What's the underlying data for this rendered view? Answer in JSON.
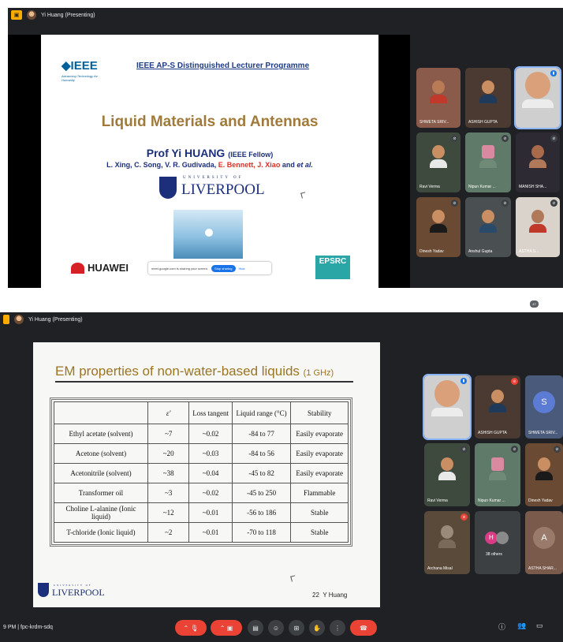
{
  "screenshot1": {
    "topbar": {
      "pin_icon": "present-to-all-icon",
      "presenter_label": "Yi Huang (Presenting)"
    },
    "slide": {
      "ieee_logo": "IEEE",
      "ieee_tagline": "Advancing Technology for Humanity",
      "programme": "IEEE AP-S Distinguished Lecturer Programme",
      "title": "Liquid Materials and Antennas",
      "presenter": "Prof Yi HUANG",
      "presenter_suffix": "(IEEE Fellow)",
      "authors_black": "L. Xing, C. Song, V. R. Gudivada,",
      "authors_red": "E. Bennett, J. Xiao",
      "authors_and": "and",
      "authors_etal": "et al.",
      "university_small": "UNIVERSITY OF",
      "university_big": "LIVERPOOL",
      "sponsor_left": "HUAWEI",
      "sponsor_right": "EPSRC",
      "share_notice": "meet.google.com is sharing your screen.",
      "share_stop": "Stop sharing",
      "share_hide": "Hide"
    },
    "tiles": [
      {
        "name": "SHWETA SRIV..."
      },
      {
        "name": "ASHISH GUPTA"
      },
      {
        "name": ""
      },
      {
        "name": "Ravi Verma"
      },
      {
        "name": "Nipun Kumar ..."
      },
      {
        "name": "MANISH SHA..."
      },
      {
        "name": "Dinesh Yadav"
      },
      {
        "name": "Anshul Gupta"
      },
      {
        "name": "ASTHA S..."
      }
    ]
  },
  "screenshot2": {
    "topbar": {
      "presenter_label": "Yi Huang (Presenting)"
    },
    "slide": {
      "title": "EM properties of non-water-based liquids",
      "title_suffix": "(1 GHz)",
      "table_headers": [
        "",
        "ε'",
        "Loss tangent",
        "Liquid range (°C)",
        "Stability"
      ],
      "table_rows": [
        [
          "Ethyl acetate (solvent)",
          "~7",
          "~0.02",
          "-84 to 77",
          "Easily evaporate"
        ],
        [
          "Acetone (solvent)",
          "~20",
          "~0.03",
          "-84 to 56",
          "Easily evaporate"
        ],
        [
          "Acetonitrile (solvent)",
          "~38",
          "~0.04",
          "-45 to 82",
          "Easily evaporate"
        ],
        [
          "Transformer oil",
          "~3",
          "~0.02",
          "-45 to 250",
          "Flammable"
        ],
        [
          "Choline L-alanine (Ionic liquid)",
          "~12",
          "~0.01",
          "-56 to 186",
          "Stable"
        ],
        [
          "T-chloride (Ionic liquid)",
          "~2",
          "~0.01",
          "-70 to 118",
          "Stable"
        ]
      ],
      "university_small": "UNIVERSITY OF",
      "university_big": "LIVERPOOL",
      "page_number": "22",
      "footer_name": "Y Huang"
    },
    "tiles": [
      {
        "name": ""
      },
      {
        "name": "ASHISH GUPTA"
      },
      {
        "name": "SHWETA SRIV...",
        "letter": "S"
      },
      {
        "name": "Ravi Verma"
      },
      {
        "name": "Nipun Kumar ..."
      },
      {
        "name": "Dinesh Yadav"
      },
      {
        "name": "Archana Misal"
      },
      {
        "name": "38 others",
        "letter": "H"
      },
      {
        "name": "ASTHA SHAR...",
        "letter": "A"
      }
    ],
    "bottombar": {
      "time_meeting": "9 PM | fpc-krdm-sdq",
      "participants_count": "47"
    }
  },
  "colors": {
    "meet_bg": "#202124",
    "tile_bg": "#3c4043",
    "accent_blue": "#1a73e8",
    "end_call_red": "#ea4335",
    "slide_gold": "#9b7521"
  }
}
